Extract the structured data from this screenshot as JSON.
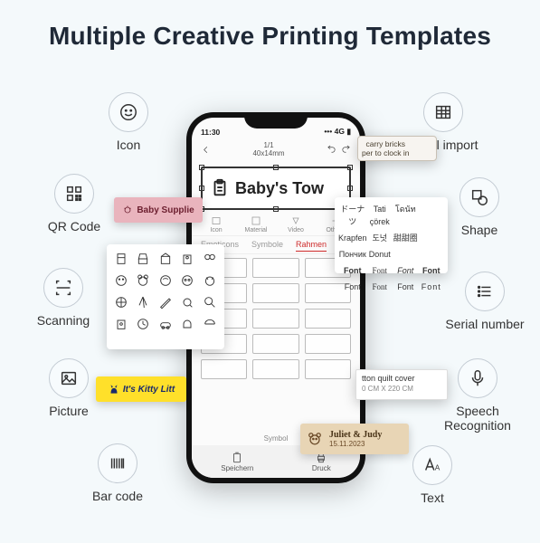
{
  "heading": "Multiple Creative Printing Templates",
  "features": {
    "icon": "Icon",
    "qr": "QR Code",
    "scan": "Scanning",
    "picture": "Picture",
    "barcode": "Bar code",
    "excel": "Excel import",
    "shape": "Shape",
    "serial": "Serial number",
    "speech": "Speech\nRecognition",
    "text": "Text"
  },
  "phone": {
    "time": "11:30",
    "page": "1/1",
    "paper": "40x14mm",
    "label_text": "Baby's Tow",
    "tabs": {
      "a": "Emoticons",
      "b": "Symbole",
      "c": "Rahmen"
    },
    "bottom": {
      "save": "Speichern",
      "print": "Druck",
      "symbol": "Symbol"
    }
  },
  "overlays": {
    "pink": "Baby Supplie",
    "yellow": "It's Kitty Litt",
    "bricks": "carry bricks\nper to clock in",
    "cotton_title": "tton quilt cover",
    "cotton_dim": "0 CM X 220 CM",
    "juliet_name": "Juliet & Judy",
    "juliet_date": "15.11.2023",
    "fonts": [
      "ドーナツ",
      "Tati çörek",
      "โดนัท",
      "",
      "Krapfen",
      "도넛",
      "甜甜圈",
      "",
      "Пончик",
      "Donut",
      "",
      "",
      "Font",
      "Font",
      "Font",
      "Font",
      "Font",
      "Font",
      "Font",
      "Font"
    ]
  }
}
